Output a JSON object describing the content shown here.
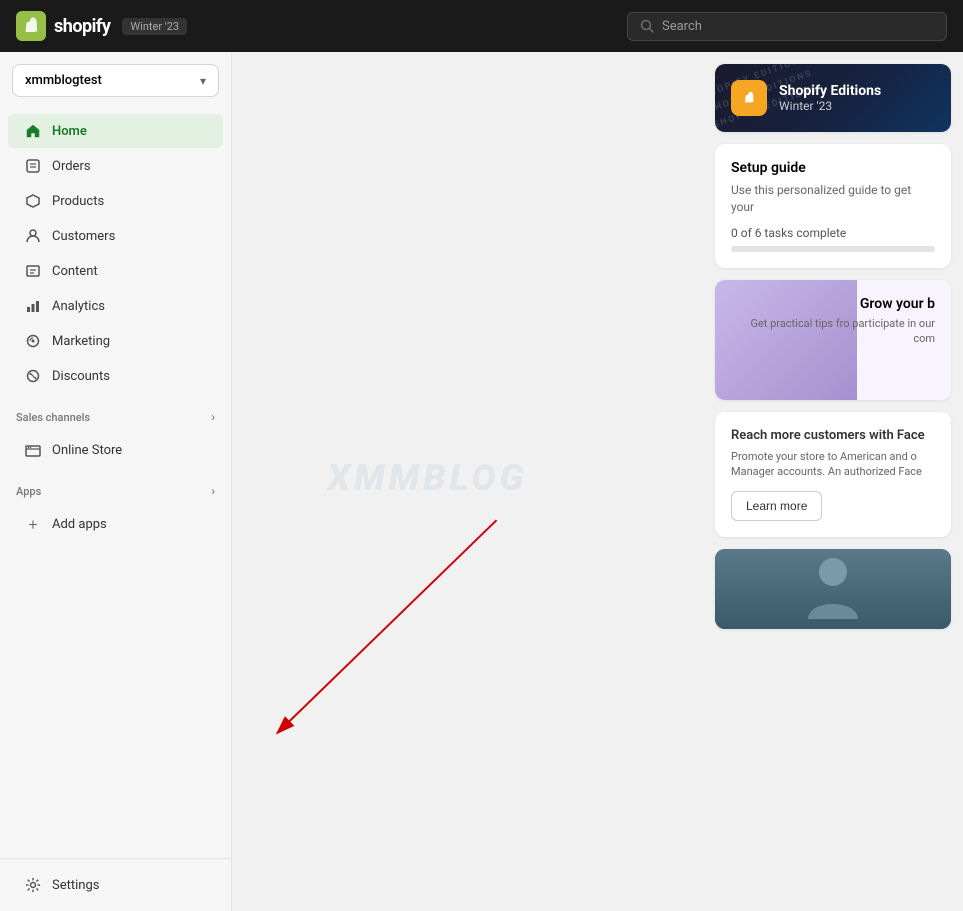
{
  "header": {
    "brand": "shopify",
    "brand_label": "shopify",
    "badge": "Winter '23",
    "search_placeholder": "Search"
  },
  "sidebar": {
    "store_name": "xmmblogtest",
    "nav_items": [
      {
        "id": "home",
        "label": "Home",
        "icon": "home-icon",
        "active": true
      },
      {
        "id": "orders",
        "label": "Orders",
        "icon": "orders-icon",
        "active": false
      },
      {
        "id": "products",
        "label": "Products",
        "icon": "products-icon",
        "active": false
      },
      {
        "id": "customers",
        "label": "Customers",
        "icon": "customers-icon",
        "active": false
      },
      {
        "id": "content",
        "label": "Content",
        "icon": "content-icon",
        "active": false
      },
      {
        "id": "analytics",
        "label": "Analytics",
        "icon": "analytics-icon",
        "active": false
      },
      {
        "id": "marketing",
        "label": "Marketing",
        "icon": "marketing-icon",
        "active": false
      },
      {
        "id": "discounts",
        "label": "Discounts",
        "icon": "discounts-icon",
        "active": false
      }
    ],
    "sales_channels_label": "Sales channels",
    "sales_channels_items": [
      {
        "id": "online-store",
        "label": "Online Store",
        "icon": "online-store-icon"
      }
    ],
    "apps_label": "Apps",
    "add_apps_label": "Add apps",
    "settings_label": "Settings"
  },
  "right_panel": {
    "editions": {
      "title": "Shopify Editions",
      "subtitle": "Winter '23"
    },
    "setup": {
      "title": "Setup guide",
      "desc": "Use this personalized guide to get your",
      "progress_text": "0 of 6 tasks complete"
    },
    "grow": {
      "title": "Grow your b",
      "desc": "Get practical tips fro participate in our com"
    },
    "facebook": {
      "title": "Reach more customers with Face",
      "desc": "Promote your store to American and o Manager accounts. An authorized Face",
      "btn_label": "Learn more"
    }
  }
}
